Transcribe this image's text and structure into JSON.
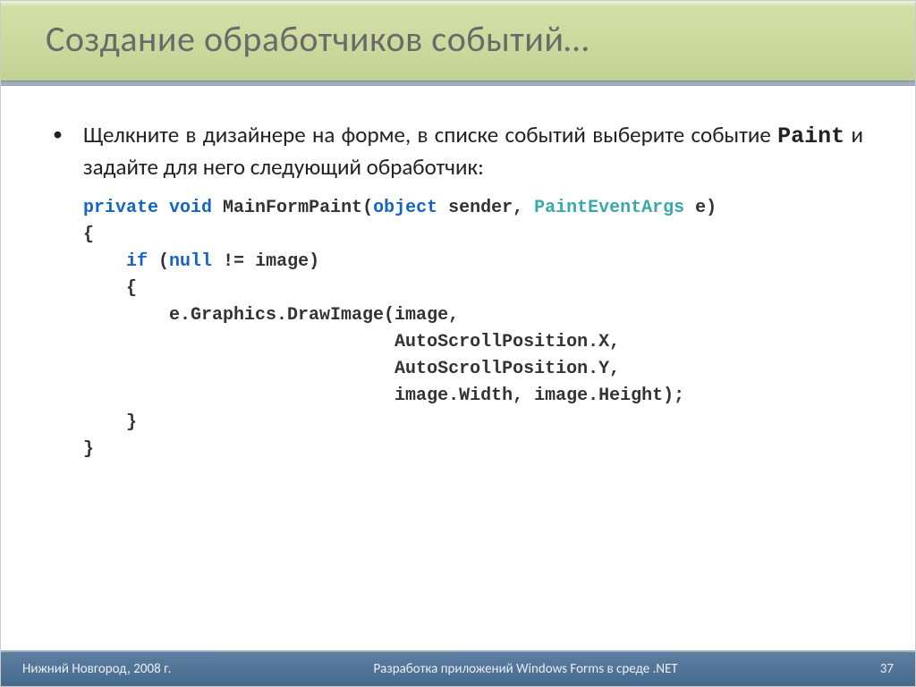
{
  "slide": {
    "title": "Создание обработчиков событий…",
    "bullet_prefix": "Щелкните в дизайнере на форме, в списке событий выберите событие ",
    "bullet_code": "Paint",
    "bullet_suffix": " и задайте для него следующий обработчик:",
    "code": {
      "kw_private": "private",
      "kw_void": "void",
      "method": " MainFormPaint(",
      "kw_object": "object",
      "sender": " sender, ",
      "type_paint": "PaintEventArgs",
      "e_paren": " e)",
      "open1": "{",
      "if_pre": "    ",
      "kw_if": "if",
      "if_open": " (",
      "kw_null": "null",
      "if_rest": " != image)",
      "open2": "    {",
      "draw": "        e.Graphics.DrawImage(image,",
      "asx": "                             AutoScrollPosition.X,",
      "asy": "                             AutoScrollPosition.Y,",
      "wh": "                             image.Width, image.Height);",
      "close2": "    }",
      "close1": "}"
    }
  },
  "footer": {
    "left": "Нижний Новгород, 2008 г.",
    "center": "Разработка приложений Windows Forms в среде .NET",
    "right": "37"
  }
}
